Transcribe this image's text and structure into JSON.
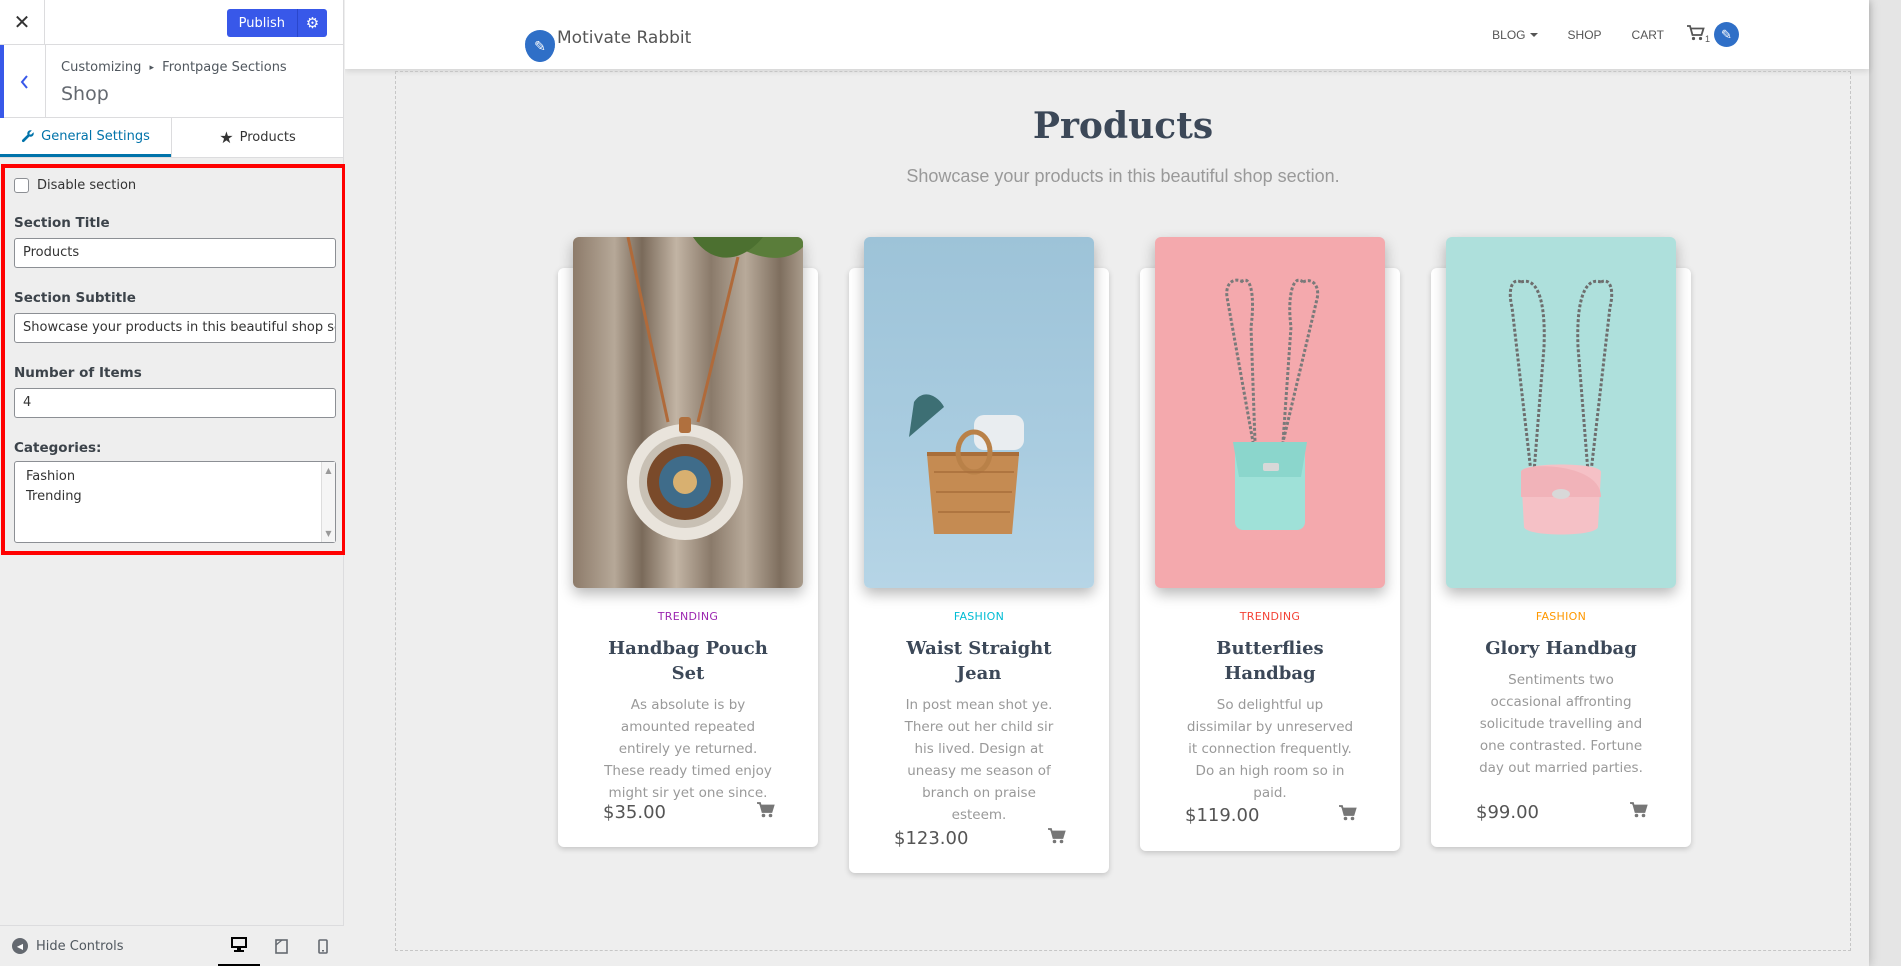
{
  "topbar": {
    "close_glyph": "✕",
    "publish_label": "Publish",
    "gear_glyph": "⚙"
  },
  "section": {
    "back_glyph": "‹",
    "crumb_parent": "Customizing",
    "crumb_arrow": "▸",
    "crumb_child": "Frontpage Sections",
    "name": "Shop"
  },
  "tabs": [
    {
      "label": "General Settings",
      "icon": "wrench-icon",
      "glyph": "🔧",
      "active": true
    },
    {
      "label": "Products",
      "icon": "star-icon",
      "glyph": "★",
      "active": false
    }
  ],
  "controls": {
    "disable_label": "Disable section",
    "disable_checked": false,
    "title_label": "Section Title",
    "title_value": "Products",
    "subtitle_label": "Section Subtitle",
    "subtitle_value": "Showcase your products in this beautiful shop se",
    "items_label": "Number of Items",
    "items_value": "4",
    "categories_label": "Categories:",
    "categories": [
      "Fashion",
      "Trending"
    ],
    "scroll_up": "▲",
    "scroll_down": "▼"
  },
  "footer": {
    "hide_label": "Hide Controls",
    "hide_glyph": "◀",
    "desktop_glyph": "🖥",
    "tablet_glyph": "▭",
    "mobile_glyph": "▯"
  },
  "site": {
    "logo_text": "Motivate Rabbit",
    "logo_glyph": "✎",
    "menu": [
      {
        "label": "Blog",
        "dropdown": true
      },
      {
        "label": "Shop",
        "dropdown": false
      },
      {
        "label": "Cart",
        "dropdown": false
      }
    ],
    "cart_glyph": "🛒",
    "cart_count": "1",
    "edit_glyph": "✎",
    "title": "Products",
    "subtitle": "Showcase your products in this beautiful shop section."
  },
  "products": [
    {
      "category": "Trending",
      "category_color": "#9c27b0",
      "title": "Handbag Pouch Set",
      "desc": "As absolute is by amounted repeated entirely ye returned. These ready timed enjoy might sir yet one since.",
      "price": "$35.00",
      "cart_glyph": "🛒"
    },
    {
      "category": "Fashion",
      "category_color": "#00bcd4",
      "title": "Waist Straight Jean",
      "desc": "In post mean shot ye. There out her child sir his lived. Design at uneasy me season of branch on praise esteem.",
      "price": "$123.00",
      "cart_glyph": "🛒"
    },
    {
      "category": "Trending",
      "category_color": "#f44336",
      "title": "Butterflies Handbag",
      "desc": "So delightful up dissimilar by unreserved it connection frequently. Do an high room so in paid.",
      "price": "$119.00",
      "cart_glyph": "🛒"
    },
    {
      "category": "Fashion",
      "category_color": "#ff9800",
      "title": "Glory Handbag",
      "desc": "Sentiments two occasional affronting solicitude travelling and one contrasted. Fortune day out married parties.",
      "price": "$99.00",
      "cart_glyph": "🛒"
    }
  ]
}
